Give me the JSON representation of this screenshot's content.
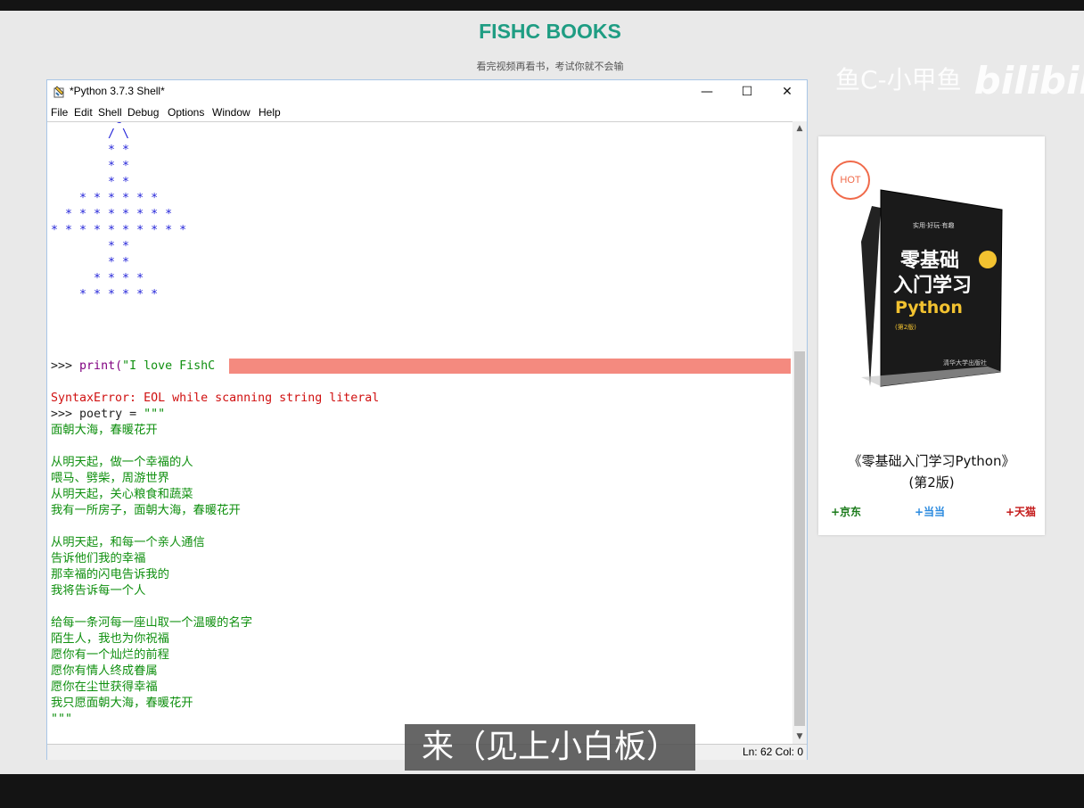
{
  "site": {
    "title": "FISHC BOOKS",
    "subtitle": "看完视频再看书，考试你就不会输"
  },
  "watermark": {
    "text": "鱼C-小甲鱼",
    "logo": "bilibili"
  },
  "window": {
    "title": "*Python 3.7.3 Shell*",
    "controls": {
      "minimize": "—",
      "maximize": "☐",
      "close": "✕"
    },
    "menu": [
      "File",
      "Edit",
      "Shell",
      "Debug",
      "Options",
      "Window",
      "Help"
    ],
    "status": "Ln: 62  Col: 0"
  },
  "shell": {
    "tree_art": [
      "         @",
      "        / \\",
      "        * *",
      "        * *",
      "        * *",
      "    * * * * * *",
      "  * * * * * * * *",
      "* * * * * * * * * *",
      "        * *",
      "        * *",
      "      * * * *",
      "    * * * * * *"
    ],
    "prompt": ">>>",
    "cmd1_fn": "print(",
    "cmd1_str": "\"I love FishC",
    "error": "SyntaxError: EOL while scanning string literal",
    "cmd2": "poetry = ",
    "cmd2_str": "\"\"\"",
    "poem_lines": [
      "面朝大海，春暖花开",
      "",
      "从明天起，做一个幸福的人",
      "喂马、劈柴，周游世界",
      "从明天起，关心粮食和蔬菜",
      "我有一所房子，面朝大海，春暖花开",
      "",
      "从明天起，和每一个亲人通信",
      "告诉他们我的幸福",
      "那幸福的闪电告诉我的",
      "我将告诉每一个人",
      "",
      "给每一条河每一座山取一个温暖的名字",
      "陌生人，我也为你祝福",
      "愿你有一个灿烂的前程",
      "愿你有情人终成眷属",
      "愿你在尘世获得幸福",
      "我只愿面朝大海，春暖花开",
      "\"\"\""
    ]
  },
  "caption": "来（见上小白板）",
  "book_card": {
    "badge": "HOT",
    "cover": {
      "small_top": "实用·好玩·有趣",
      "line1": "零基础",
      "line2": "入门学习",
      "line3": "Python",
      "edition_tag": "(第2版)",
      "publisher": "清华大学出版社"
    },
    "title": "《零基础入门学习Python》",
    "edition": "(第2版)",
    "stores": [
      {
        "label": "+京东",
        "color": "#1a7a1a"
      },
      {
        "label": "+当当",
        "color": "#2a8adf"
      },
      {
        "label": "+天猫",
        "color": "#c41a1a"
      }
    ]
  }
}
